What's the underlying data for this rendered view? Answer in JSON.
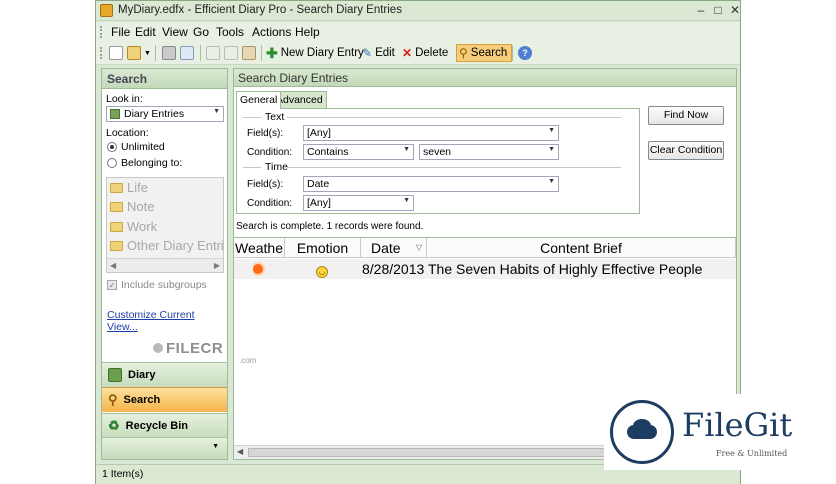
{
  "window": {
    "title": "MyDiary.edfx - Efficient Diary Pro - Search Diary Entries",
    "minimize": "–",
    "maximize": "□",
    "close": "✕"
  },
  "menu": [
    "File",
    "Edit",
    "View",
    "Go",
    "Tools",
    "Actions",
    "Help"
  ],
  "toolbar": {
    "new_entry": "New Diary Entry",
    "edit": "Edit",
    "delete": "Delete",
    "search": "Search"
  },
  "left_panel": {
    "header": "Search",
    "look_in_label": "Look in:",
    "look_in_value": "Diary Entries",
    "location_label": "Location:",
    "unlimited": "Unlimited",
    "belonging_to": "Belonging to:",
    "categories": [
      "Life",
      "Note",
      "Work",
      "Other Diary Entri"
    ],
    "include_subgroups": "Include subgroups",
    "customize_link": "Customize Current View..."
  },
  "nav": {
    "diary": "Diary",
    "search": "Search",
    "recycle_bin": "Recycle Bin"
  },
  "search_panel": {
    "header": "Search Diary Entries",
    "tabs": [
      "General",
      "Advanced"
    ],
    "text_group": "Text",
    "fields_label": "Field(s):",
    "fields_value": "[Any]",
    "condition_label": "Condition:",
    "condition_value": "Contains",
    "search_text": "seven",
    "time_group": "Time",
    "time_fields_value": "Date",
    "time_condition_value": "[Any]",
    "find_now": "Find Now",
    "clear_condition": "Clear Condition",
    "status": "Search is complete. 1 records were found."
  },
  "results": {
    "columns": [
      "Weathe",
      "Emotion",
      "Date",
      "Content Brief"
    ],
    "rows": [
      {
        "weather_icon": "sun-icon",
        "emotion_icon": "smiley-icon",
        "date": "8/28/2013",
        "brief": "The Seven Habits of Highly Effective People"
      }
    ]
  },
  "statusbar": {
    "items": "1 Item(s)"
  },
  "watermarks": {
    "filecr": "FILECR",
    "filecr_suffix": ".com",
    "filegit": "FileGit",
    "filegit_tag": "Free & Unlimited"
  },
  "colors": {
    "accent": "#f6b44a",
    "frame": "#d9e8d2",
    "link": "#1c3fa8"
  }
}
